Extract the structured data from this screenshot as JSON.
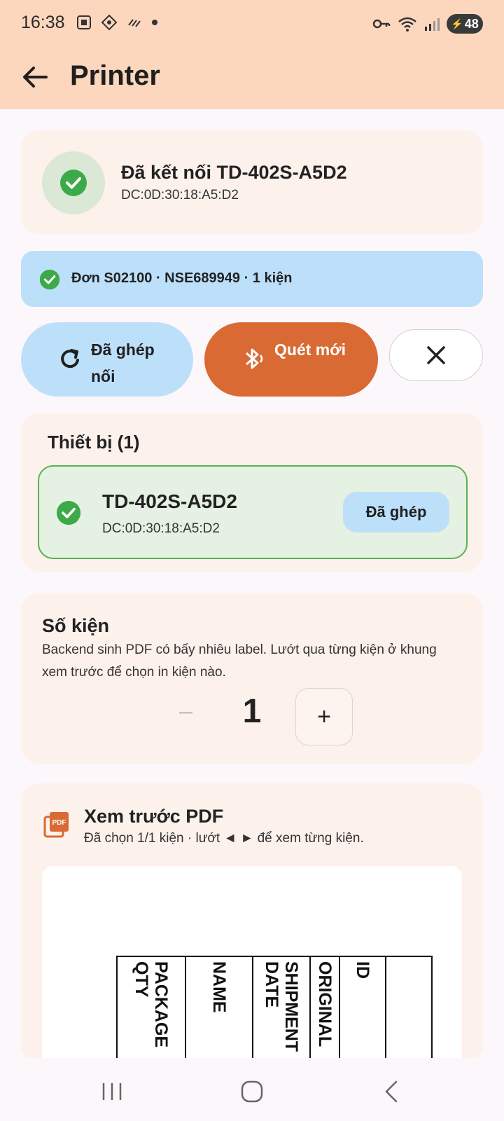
{
  "status_bar": {
    "time": "16:38",
    "battery": "48"
  },
  "app_bar": {
    "title": "Printer"
  },
  "connection": {
    "title": "Đã kết nối TD-402S-A5D2",
    "mac": "DC:0D:30:18:A5:D2"
  },
  "order": {
    "text": "Đơn S02100 · NSE689949 · 1 kiện"
  },
  "actions": {
    "paired_label": "Đã ghép nối",
    "scan_label": "Quét mới"
  },
  "devices": {
    "title": "Thiết bị (1)",
    "items": [
      {
        "name": "TD-402S-A5D2",
        "mac": "DC:0D:30:18:A5:D2",
        "badge": "Đã ghép"
      }
    ]
  },
  "quantity": {
    "title": "Số kiện",
    "description": "Backend sinh PDF có bấy nhiêu label. Lướt qua từng kiện ở khung xem trước để chọn in kiện nào.",
    "minus": "–",
    "value": "1",
    "plus": "+"
  },
  "pdf_preview": {
    "title": "Xem trước PDF",
    "subtitle": "Đã chọn 1/1 kiện · lướt ◄ ► để xem từng kiện.",
    "columns": [
      "PACKAGE\nQTY",
      "NAME",
      "SHIPMENT\nDATE",
      "ORIGINAL",
      "ID",
      ""
    ]
  },
  "colors": {
    "header_bg": "#fdd7bd",
    "accent": "#d96a33",
    "success": "#3daa4a",
    "info_bg": "#bde0fa"
  }
}
